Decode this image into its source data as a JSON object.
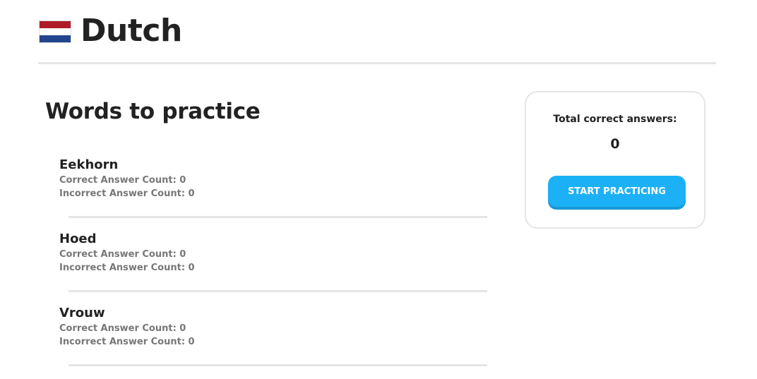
{
  "header": {
    "title": "Dutch",
    "flag_colors": [
      "#ae1c28",
      "#ffffff",
      "#21468b"
    ]
  },
  "words_section": {
    "title": "Words to practice",
    "items": [
      {
        "word": "Eekhorn",
        "correct": "Correct Answer Count: 0",
        "incorrect": "Incorrect Answer Count: 0"
      },
      {
        "word": "Hoed",
        "correct": "Correct Answer Count: 0",
        "incorrect": "Incorrect Answer Count: 0"
      },
      {
        "word": "Vrouw",
        "correct": "Correct Answer Count: 0",
        "incorrect": "Incorrect Answer Count: 0"
      }
    ]
  },
  "stats": {
    "label": "Total correct answers:",
    "value": "0",
    "button_label": "START PRACTICING",
    "button_color": "#1cb0f6"
  }
}
